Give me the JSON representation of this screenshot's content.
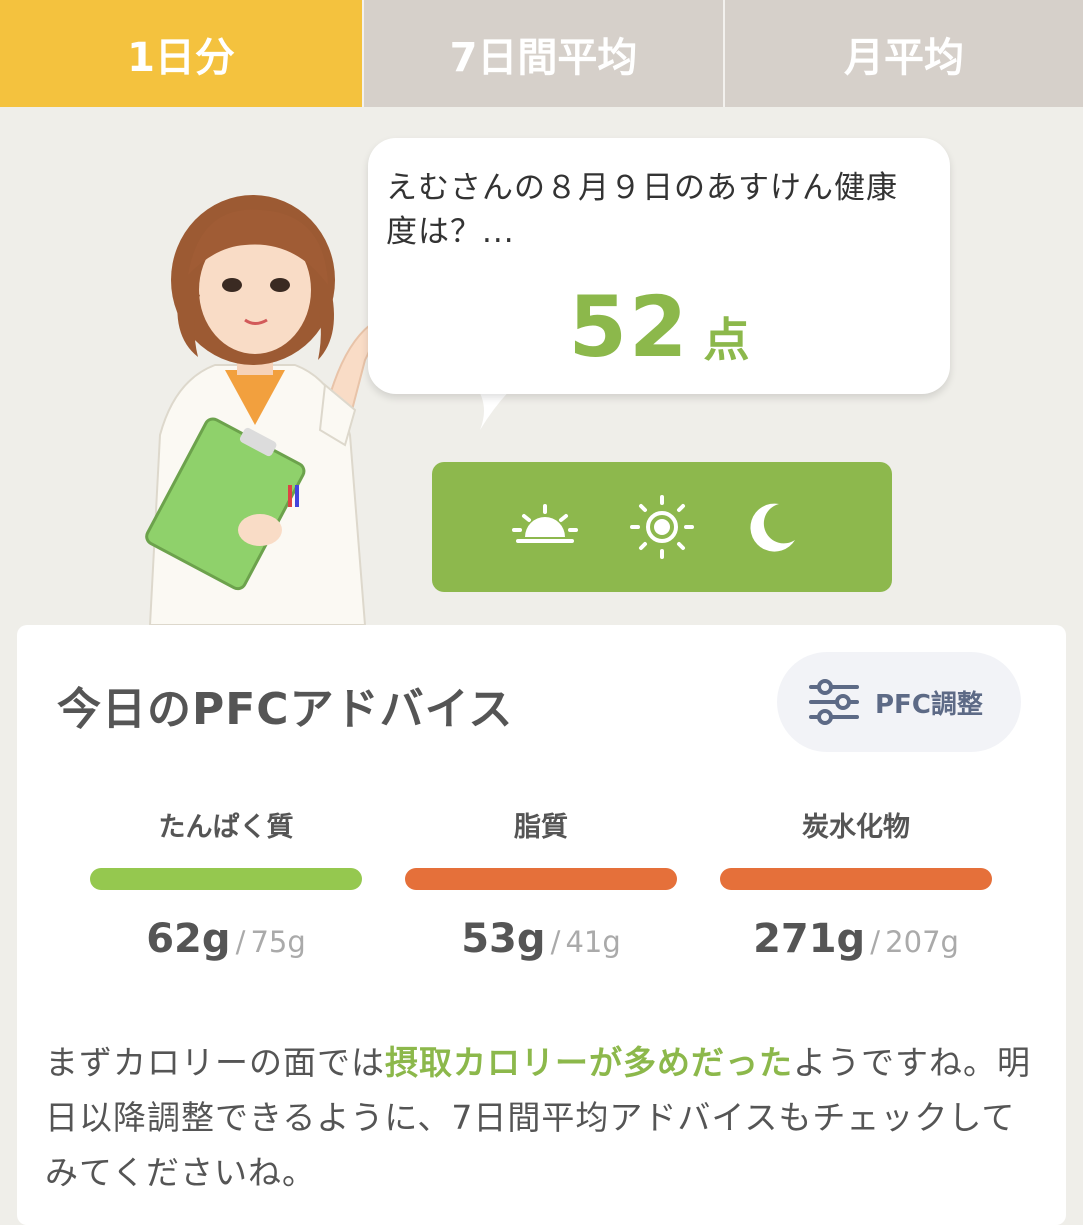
{
  "tabs": [
    {
      "label": "1日分",
      "active": true
    },
    {
      "label": "7日間平均",
      "active": false
    },
    {
      "label": "月平均",
      "active": false
    }
  ],
  "bubble": {
    "message": "えむさんの８月９日のあすけん健康度は？...",
    "score_value": "52",
    "score_unit": "点"
  },
  "meal_times": [
    {
      "icon": "sunrise-icon"
    },
    {
      "icon": "sun-icon"
    },
    {
      "icon": "moon-icon"
    }
  ],
  "pfc": {
    "title": "今日のPFCアドバイス",
    "adjust_label": "PFC調整",
    "macros": [
      {
        "name": "たんぱく質",
        "value": "62g",
        "target": "75g",
        "ratio": 0.83,
        "status_color": "#95c84f"
      },
      {
        "name": "脂質",
        "value": "53g",
        "target": "41g",
        "ratio": 1.29,
        "status_color": "#e5703a"
      },
      {
        "name": "炭水化物",
        "value": "271g",
        "target": "207g",
        "ratio": 1.31,
        "status_color": "#e5703a"
      }
    ],
    "separator": "/"
  },
  "advice": {
    "before": "まずカロリーの面では",
    "highlight": "摂取カロリーが多めだった",
    "after": "ようですね。明日以降調整できるように、7日間平均アドバイスもチェックしてみてくださいね。"
  },
  "colors": {
    "accent_yellow": "#f4c23e",
    "accent_green": "#8db84d",
    "over_orange": "#e5703a",
    "tab_inactive": "#d6d0ca"
  }
}
